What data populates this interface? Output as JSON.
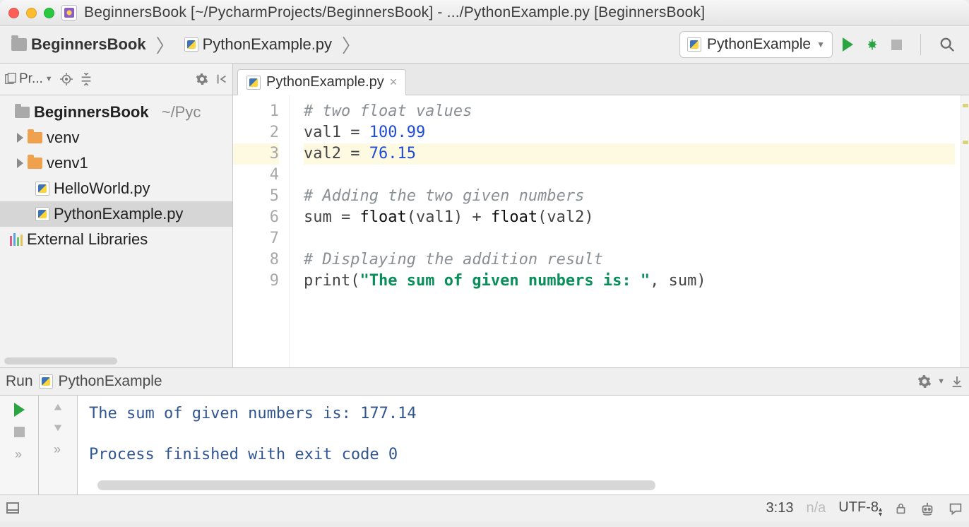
{
  "titlebar": {
    "title": "BeginnersBook [~/PycharmProjects/BeginnersBook] - .../PythonExample.py [BeginnersBook]"
  },
  "breadcrumb": {
    "project": "BeginnersBook",
    "file": "PythonExample.py"
  },
  "run_config": {
    "name": "PythonExample"
  },
  "sidebar": {
    "title": "Pr...",
    "root_name": "BeginnersBook",
    "root_path": "~/Pyc",
    "items": [
      {
        "name": "venv",
        "type": "folder"
      },
      {
        "name": "venv1",
        "type": "folder"
      },
      {
        "name": "HelloWorld.py",
        "type": "pyfile"
      },
      {
        "name": "PythonExample.py",
        "type": "pyfile",
        "selected": true
      }
    ],
    "ext_libs": "External Libraries"
  },
  "editor": {
    "tab_label": "PythonExample.py",
    "line_numbers": [
      "1",
      "2",
      "3",
      "4",
      "5",
      "6",
      "7",
      "8",
      "9"
    ],
    "code": {
      "l1": "# two float values",
      "l2a": "val1 = ",
      "l2b": "100.99",
      "l3a": "val2 = ",
      "l3b": "76.15",
      "l4": "",
      "l5": "# Adding the two given numbers",
      "l6a": "sum = ",
      "l6b": "float",
      "l6c": "(val1) + ",
      "l6d": "float",
      "l6e": "(val2)",
      "l7": "",
      "l8": "# Displaying the addition result",
      "l9a": "print(",
      "l9b": "\"The sum of given numbers is: \"",
      "l9c": ", sum)"
    }
  },
  "run_panel": {
    "label": "Run",
    "name": "PythonExample",
    "output_line": "The sum of given numbers is:  177.14",
    "exit_line": "Process finished with exit code 0"
  },
  "status": {
    "cursor": "3:13",
    "na": "n/a",
    "encoding": "UTF-8"
  }
}
